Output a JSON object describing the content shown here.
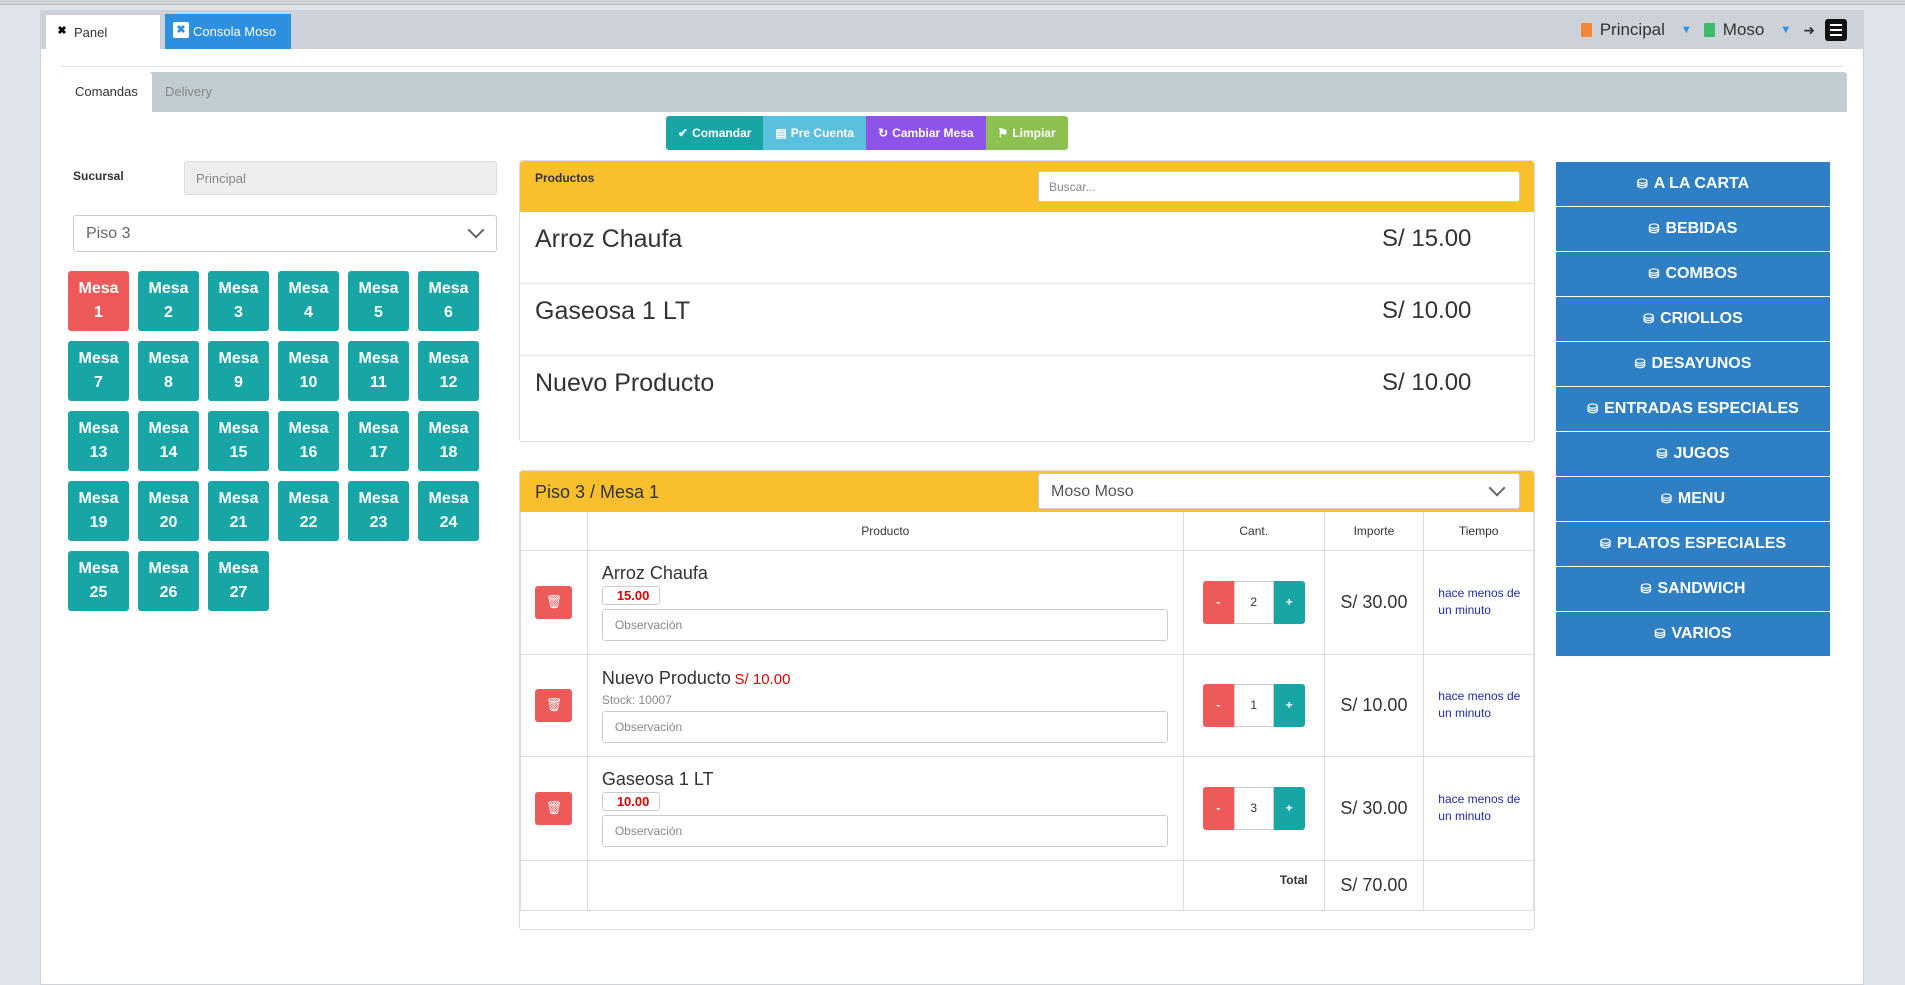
{
  "tabs": [
    {
      "label": "Panel",
      "close": "✖"
    },
    {
      "label": "Consola Moso",
      "close": "✖"
    }
  ],
  "header": {
    "sucursal_selector": "Principal",
    "user_selector": "Moso"
  },
  "subtabs": [
    "Comandas",
    "Delivery"
  ],
  "toolbar": {
    "comandar": "Comandar",
    "pre_cuenta": "Pre Cuenta",
    "cambiar_mesa": "Cambiar Mesa",
    "limpiar": "Limpiar"
  },
  "left": {
    "sucursal_label": "Sucursal",
    "sucursal_value": "Principal",
    "piso_selected": "Piso 3",
    "mesas": [
      "Mesa 1",
      "Mesa 2",
      "Mesa 3",
      "Mesa 4",
      "Mesa 5",
      "Mesa 6",
      "Mesa 7",
      "Mesa 8",
      "Mesa 9",
      "Mesa 10",
      "Mesa 11",
      "Mesa 12",
      "Mesa 13",
      "Mesa 14",
      "Mesa 15",
      "Mesa 16",
      "Mesa 17",
      "Mesa 18",
      "Mesa 19",
      "Mesa 20",
      "Mesa 21",
      "Mesa 22",
      "Mesa 23",
      "Mesa 24",
      "Mesa 25",
      "Mesa 26",
      "Mesa 27"
    ],
    "active_mesa": "Mesa 1"
  },
  "productos": {
    "title": "Productos",
    "search_placeholder": "Buscar...",
    "items": [
      {
        "name": "Arroz Chaufa",
        "price": "S/ 15.00"
      },
      {
        "name": "Gaseosa 1 LT",
        "price": "S/ 10.00"
      },
      {
        "name": "Nuevo Producto",
        "price": "S/ 10.00"
      }
    ]
  },
  "orden": {
    "title": "Piso 3 / Mesa 1",
    "mozo": "Moso Moso",
    "columns": {
      "producto": "Producto",
      "cant": "Cant.",
      "importe": "Importe",
      "tiempo": "Tiempo"
    },
    "obs_placeholder": "Observación",
    "items": [
      {
        "name": "Arroz Chaufa",
        "unit_price": "15.00",
        "qty": "2",
        "importe": "S/ 30.00",
        "tiempo": "hace menos de un minuto"
      },
      {
        "name": "Nuevo Producto",
        "unit_price": "S/ 10.00",
        "stock": "Stock: 10007",
        "qty": "1",
        "importe": "S/ 10.00",
        "tiempo": "hace menos de un minuto"
      },
      {
        "name": "Gaseosa 1 LT",
        "unit_price": "10.00",
        "qty": "3",
        "importe": "S/ 30.00",
        "tiempo": "hace menos de un minuto"
      }
    ],
    "total_label": "Total",
    "total_value": "S/ 70.00",
    "minus": "-",
    "plus": "+"
  },
  "categorias": [
    "A LA CARTA",
    "BEBIDAS",
    "COMBOS",
    "CRIOLLOS",
    "DESAYUNOS",
    "ENTRADAS ESPECIALES",
    "JUGOS",
    "MENU",
    "PLATOS ESPECIALES",
    "SANDWICH",
    "VARIOS"
  ],
  "colors": {
    "teal": "#17a5a6",
    "red": "#ee5a5a",
    "yellow": "#f8c02c",
    "blue": "#2f7fc5",
    "info": "#5bc0de",
    "purple": "#8e54e9",
    "green": "#8cc152"
  }
}
